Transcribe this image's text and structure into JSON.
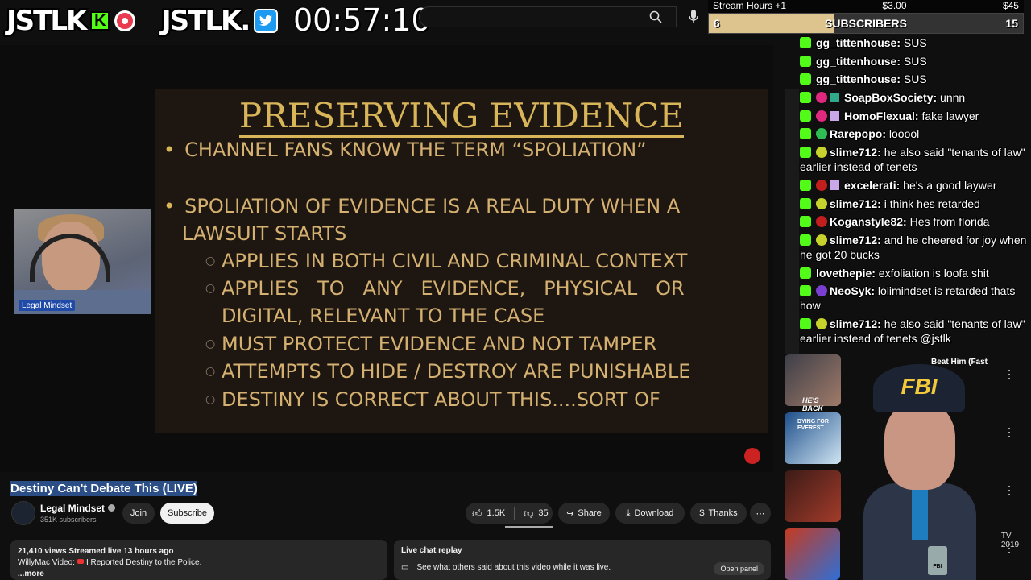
{
  "overlay": {
    "kick_name": "JSTLK",
    "kick_glyph": "K",
    "twitter_name": "JSTLK.",
    "timer": "00:57:10"
  },
  "sub_widget": {
    "left_label": "Stream Hours +1",
    "mid_amount": "$3.00",
    "right_amount": "$45",
    "current": "6",
    "title": "SUBSCRIBERS",
    "goal": "15",
    "progress": 0.4
  },
  "slide": {
    "title": "PRESERVING EVIDENCE",
    "bullet1": "CHANNEL FANS KNOW THE TERM “SPOLIATION”",
    "bullet2_line1": "SPOLIATION OF EVIDENCE IS A REAL DUTY WHEN A",
    "bullet2_line2": "LAWSUIT STARTS",
    "sub1": "APPLIES IN BOTH CIVIL AND CRIMINAL CONTEXT",
    "sub2_line1": "APPLIES   TO   ANY   EVIDENCE,   PHYSICAL   OR",
    "sub2_line2": "DIGITAL, RELEVANT TO THE CASE",
    "sub3": "MUST PROTECT EVIDENCE AND NOT TAMPER",
    "sub4": "ATTEMPTS TO HIDE / DESTROY ARE PUNISHABLE",
    "sub5": "DESTINY IS CORRECT ABOUT THIS....SORT OF"
  },
  "webcam": {
    "badge": "Legal Mindset"
  },
  "chat": [
    {
      "user": "gg_tittenhouse:",
      "msg": " SUS"
    },
    {
      "user": "gg_tittenhouse:",
      "msg": " SUS"
    },
    {
      "user": "gg_tittenhouse:",
      "msg": " SUS"
    },
    {
      "user": "SoapBoxSociety:",
      "msg": " unnn"
    },
    {
      "user": "HomoFlexual:",
      "msg": " fake lawyer"
    },
    {
      "user": "Rarepopo:",
      "msg": " looool"
    },
    {
      "user": "slime712:",
      "msg": " he also said \"tenants of law\" earlier instead of tenets"
    },
    {
      "user": "excelerati:",
      "msg": " he's a good laywer"
    },
    {
      "user": "slime712:",
      "msg": " i think hes retarded"
    },
    {
      "user": "Koganstyle82:",
      "msg": " Hes from florida"
    },
    {
      "user": "slime712:",
      "msg": " and he cheered for joy when he got 20 bucks"
    },
    {
      "user": "lovethepie:",
      "msg": " exfoliation is loofa shit"
    },
    {
      "user": "NeoSyk:",
      "msg": " lolimindset is retarded thats how"
    },
    {
      "user": "slime712:",
      "msg": " he also said \"tenants of law\" earlier instead of tenets @jstlk"
    }
  ],
  "video": {
    "title": "Destiny Can't Debate This (LIVE)",
    "channel": "Legal Mindset",
    "subscribers": "351K subscribers",
    "join": "Join",
    "subscribe": "Subscribe",
    "likes": "1.5K",
    "dislikes": "35",
    "share": "Share",
    "download": "Download",
    "thanks": "Thanks",
    "views": "21,410 views  Streamed live 13 hours ago",
    "desc_prefix": "WillyMac Video:",
    "desc_link": "I Reported Destiny to the Police.",
    "more": "...more",
    "chat_replay_title": "Live chat replay",
    "chat_replay_desc": "See what others said about this video while it was live.",
    "open_panel": "Open panel"
  },
  "recommendations": [
    {
      "snippet": "Beat Him (Fast",
      "thumb_caption": "HE'S BACK"
    },
    {
      "snippet": "TV",
      "thumb_caption": "DYING FOR EVEREST"
    },
    {
      "snippet": "",
      "thumb_caption": ""
    },
    {
      "snippet": "TV 2019",
      "thumb_caption": ""
    }
  ],
  "sticker": {
    "cap_text": "FBI",
    "badge_text": "FBI"
  }
}
